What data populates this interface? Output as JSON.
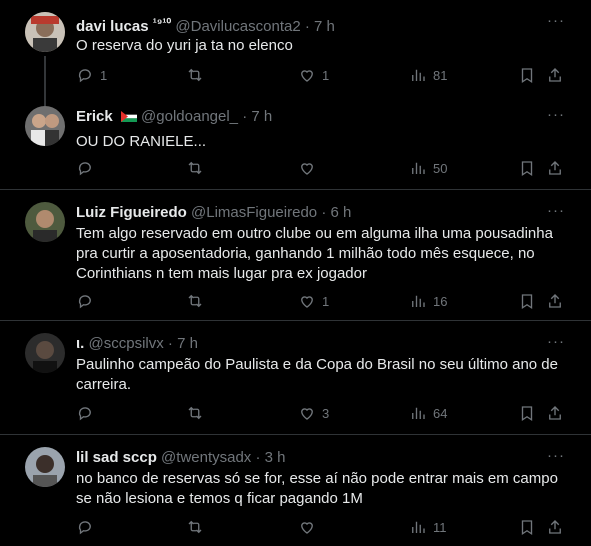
{
  "tweets": [
    {
      "name": "davi lucas",
      "badge": "¹⁹¹⁰",
      "handle": "@Davilucasconta2",
      "time": "7 h",
      "text": "O reserva do yuri ja ta no elenco",
      "replies": "1",
      "retweets": "",
      "likes": "1",
      "views": "81"
    },
    {
      "name": "Erick",
      "handle": "@goldoangel_",
      "time": "7 h",
      "text": "OU DO RANIELE...",
      "replies": "",
      "retweets": "",
      "likes": "",
      "views": "50"
    },
    {
      "name": "Luiz Figueiredo",
      "handle": "@LimasFigueiredo",
      "time": "6 h",
      "text": "Tem algo reservado em outro clube ou em alguma ilha uma pousadinha pra curtir a aposentadoria, ganhando 1 milhão todo mês esquece, no Corinthians n tem mais lugar pra ex jogador",
      "replies": "",
      "retweets": "",
      "likes": "1",
      "views": "16"
    },
    {
      "name": "ι.",
      "handle": "@sccpsilvx",
      "time": "7 h",
      "text": "Paulinho campeão do Paulista e da Copa do Brasil no seu último ano de carreira.",
      "replies": "",
      "retweets": "",
      "likes": "3",
      "views": "64"
    },
    {
      "name": "lil sad sccp",
      "handle": "@twentysadx",
      "time": "3 h",
      "text": "no banco de reservas só se for, esse aí não pode entrar mais em campo se não lesiona e temos q ficar pagando 1M",
      "replies": "",
      "retweets": "",
      "likes": "",
      "views": "11"
    }
  ],
  "separator": "·",
  "more_label": "···"
}
